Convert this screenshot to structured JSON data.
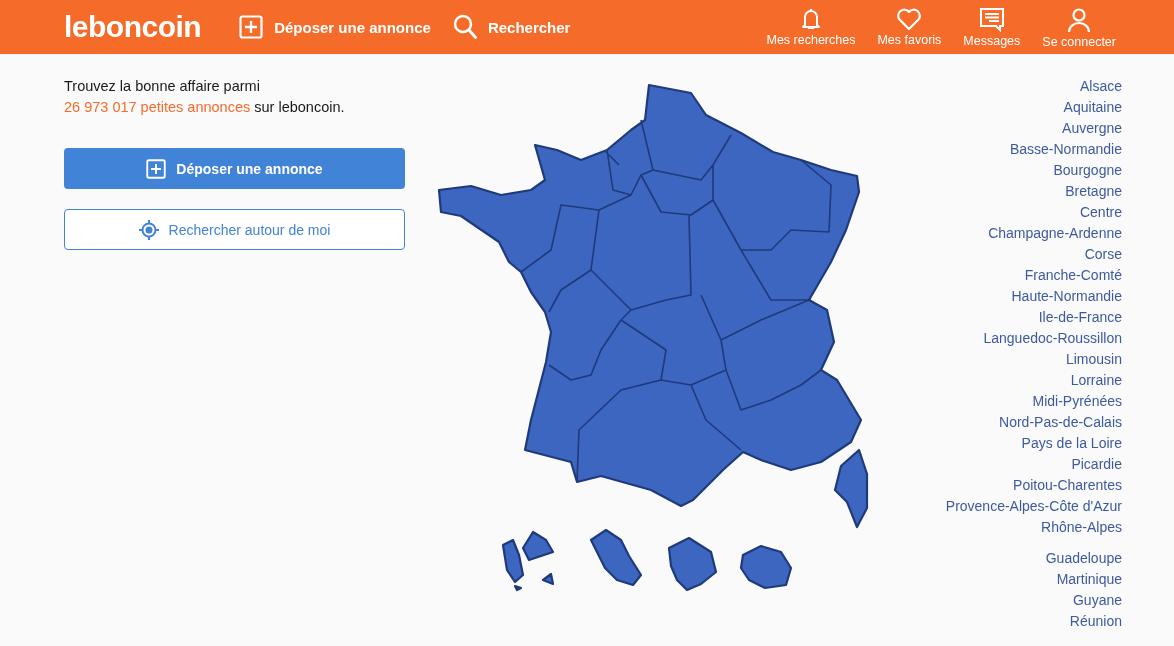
{
  "header": {
    "logo": "leboncoin",
    "actions": [
      {
        "kind": "post",
        "label": "Déposer une annonce"
      },
      {
        "kind": "search",
        "label": "Rechercher"
      }
    ],
    "nav": [
      {
        "kind": "bell",
        "label": "Mes recherches"
      },
      {
        "kind": "heart",
        "label": "Mes favoris"
      },
      {
        "kind": "message",
        "label": "Messages"
      },
      {
        "kind": "user",
        "label": "Se connecter"
      }
    ]
  },
  "intro": {
    "before": "Trouvez la bonne affaire parmi",
    "link": "26 973 017 petites annonces",
    "after": "sur leboncoin."
  },
  "buttons": [
    {
      "kind": "primary",
      "label": "Déposer une annonce"
    },
    {
      "kind": "secondary",
      "label": "Rechercher autour de moi"
    }
  ],
  "regions": [
    "Alsace",
    "Aquitaine",
    "Auvergne",
    "Basse-Normandie",
    "Bourgogne",
    "Bretagne",
    "Centre",
    "Champagne-Ardenne",
    "Corse",
    "Franche-Comté",
    "Haute-Normandie",
    "Ile-de-France",
    "Languedoc-Roussillon",
    "Limousin",
    "Lorraine",
    "Midi-Pyrénées",
    "Nord-Pas-de-Calais",
    "Pays de la Loire",
    "Picardie",
    "Poitou-Charentes",
    "Provence-Alpes-Côte d'Azur",
    "Rhône-Alpes"
  ],
  "overseas": [
    "Guadeloupe",
    "Martinique",
    "Guyane",
    "Réunion"
  ]
}
